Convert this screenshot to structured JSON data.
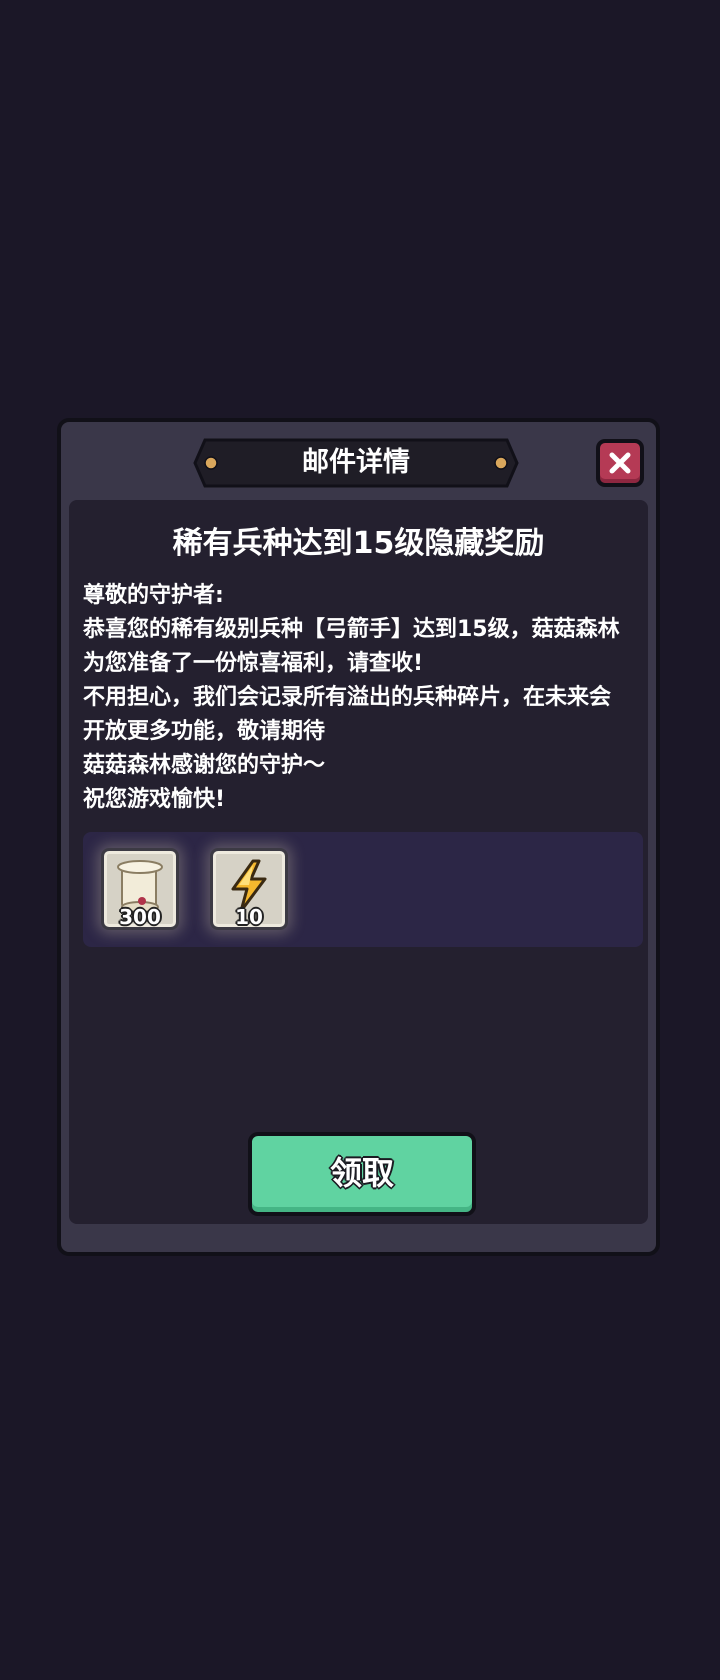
{
  "dialog": {
    "header_title": "邮件详情",
    "close_icon": "close-icon"
  },
  "mail": {
    "title": "稀有兵种达到15级隐藏奖励",
    "body": [
      "尊敬的守护者:",
      "恭喜您的稀有级别兵种【弓箭手】达到15级，菇菇森林",
      "为您准备了一份惊喜福利，请查收!",
      "不用担心，我们会记录所有溢出的兵种碎片，在未来会",
      "开放更多功能，敬请期待",
      "菇菇森林感谢您的守护～",
      "祝您游戏愉快!"
    ]
  },
  "rewards": [
    {
      "icon": "scroll-icon",
      "count": "300"
    },
    {
      "icon": "lightning-icon",
      "count": "10"
    }
  ],
  "actions": {
    "claim_label": "领取"
  },
  "colors": {
    "background": "#1b1727",
    "panel": "#3a3749",
    "claim_button": "#60d3a1",
    "close_button": "#b53a55"
  }
}
